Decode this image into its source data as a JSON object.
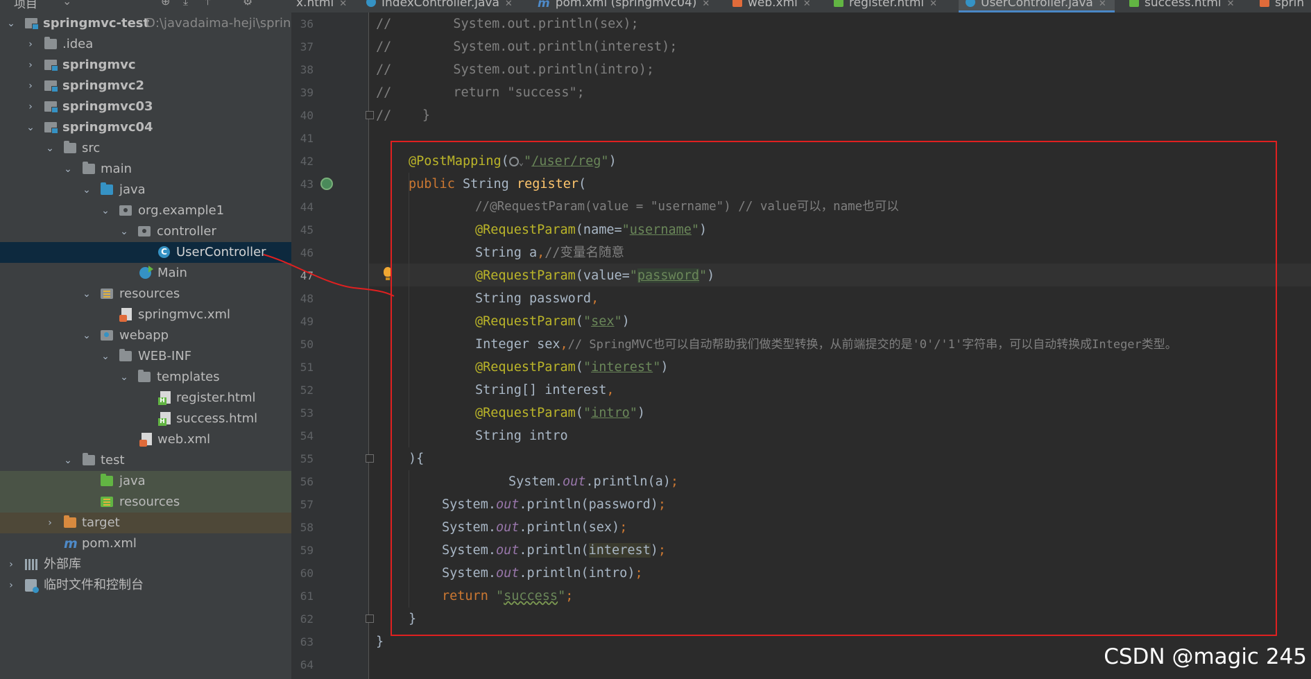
{
  "project_panel": {
    "title": "项目",
    "tree": [
      {
        "label": "springmvc-test",
        "path": "D:\\javadaima-heji\\spring",
        "bold": true,
        "expanded": true,
        "depth": 0,
        "icon": "module-folder-icon"
      },
      {
        "label": ".idea",
        "depth": 1,
        "collapsed": true,
        "icon": "folder-icon"
      },
      {
        "label": "springmvc",
        "bold": true,
        "depth": 1,
        "collapsed": true,
        "icon": "module-folder-icon"
      },
      {
        "label": "springmvc2",
        "bold": true,
        "depth": 1,
        "collapsed": true,
        "icon": "module-folder-icon"
      },
      {
        "label": "springmvc03",
        "bold": true,
        "depth": 1,
        "collapsed": true,
        "icon": "module-folder-icon"
      },
      {
        "label": "springmvc04",
        "bold": true,
        "depth": 1,
        "expanded": true,
        "icon": "module-folder-icon"
      },
      {
        "label": "src",
        "depth": 2,
        "expanded": true,
        "icon": "folder-icon"
      },
      {
        "label": "main",
        "depth": 3,
        "expanded": true,
        "icon": "folder-icon"
      },
      {
        "label": "java",
        "depth": 4,
        "expanded": true,
        "icon": "source-folder-icon"
      },
      {
        "label": "org.example1",
        "depth": 5,
        "expanded": true,
        "icon": "package-icon"
      },
      {
        "label": "controller",
        "depth": 6,
        "expanded": true,
        "icon": "package-icon"
      },
      {
        "label": "UserController",
        "depth": 7,
        "selected": true,
        "icon": "java-class-icon"
      },
      {
        "label": "Main",
        "depth": 6,
        "icon": "java-main-class-icon"
      },
      {
        "label": "resources",
        "depth": 4,
        "expanded": true,
        "icon": "resources-folder-icon"
      },
      {
        "label": "springmvc.xml",
        "depth": 5,
        "icon": "spring-xml-icon"
      },
      {
        "label": "webapp",
        "depth": 4,
        "expanded": true,
        "icon": "web-folder-icon"
      },
      {
        "label": "WEB-INF",
        "depth": 5,
        "expanded": true,
        "icon": "folder-icon"
      },
      {
        "label": "templates",
        "depth": 6,
        "expanded": true,
        "icon": "folder-icon"
      },
      {
        "label": "register.html",
        "depth": 7,
        "icon": "html-file-icon"
      },
      {
        "label": "success.html",
        "depth": 7,
        "icon": "html-file-icon"
      },
      {
        "label": "web.xml",
        "depth": 6,
        "icon": "xml-file-icon"
      },
      {
        "label": "test",
        "depth": 3,
        "expanded": true,
        "icon": "folder-icon"
      },
      {
        "label": "java",
        "depth": 4,
        "icon": "test-source-folder-icon"
      },
      {
        "label": "resources",
        "depth": 4,
        "icon": "test-resources-folder-icon"
      },
      {
        "label": "target",
        "depth": 2,
        "collapsed": true,
        "icon": "excluded-folder-icon"
      },
      {
        "label": "pom.xml",
        "depth": 2,
        "icon": "maven-icon"
      },
      {
        "label": "外部库",
        "depth": 0,
        "collapsed": true,
        "icon": "library-icon"
      },
      {
        "label": "临时文件和控制台",
        "depth": 0,
        "collapsed": true,
        "icon": "scratch-icon"
      }
    ]
  },
  "tabs": [
    {
      "label": "x.html"
    },
    {
      "label": "IndexController.java"
    },
    {
      "label": "pom.xml (springmvc04)"
    },
    {
      "label": "web.xml"
    },
    {
      "label": "register.html"
    },
    {
      "label": "UserController.java",
      "active": true
    },
    {
      "label": "success.html"
    },
    {
      "label": "sprin"
    }
  ],
  "editor": {
    "current_line": "47",
    "line_numbers": [
      "36",
      "37",
      "38",
      "39",
      "40",
      "41",
      "42",
      "43",
      "44",
      "45",
      "46",
      "47",
      "48",
      "49",
      "50",
      "51",
      "52",
      "53",
      "54",
      "55",
      "56",
      "57",
      "58",
      "59",
      "60",
      "61",
      "62",
      "63",
      "64"
    ],
    "lines": {
      "l36": {
        "a": "//",
        "b": "        System.out.println(sex);"
      },
      "l37": {
        "a": "//",
        "b": "        System.out.println(interest);"
      },
      "l38": {
        "a": "//",
        "b": "        System.out.println(intro);"
      },
      "l39": {
        "a": "//",
        "b": "        return \"success\";"
      },
      "l40": {
        "a": "//",
        "b": "    }"
      },
      "l42": {
        "ann": "@PostMapping",
        "p1": "(",
        "q1": "\"",
        "val": "/user/reg",
        "q2": "\"",
        "p2": ")"
      },
      "l43": {
        "kw": "public ",
        "type": "String ",
        "fn": "register",
        "p": "("
      },
      "l44": {
        "cm": "//@RequestParam(value = \"username\") // value可以，name也可以"
      },
      "l45": {
        "ann": "@RequestParam",
        "pre": "(name=",
        "q1": "\"",
        "val": "username",
        "q2": "\"",
        "post": ")"
      },
      "l46": {
        "txt": "String a",
        "comma": ",",
        "cm": "//变量名随意"
      },
      "l47": {
        "ann": "@RequestParam",
        "pre": "(value=",
        "q1": "\"",
        "val": "password",
        "q2": "\"",
        "post": ")"
      },
      "l48": {
        "txt": "String password",
        "comma": ","
      },
      "l49": {
        "ann": "@RequestParam",
        "pre": "(",
        "q1": "\"",
        "val": "sex",
        "q2": "\"",
        "post": ")"
      },
      "l50": {
        "txt": "Integer sex",
        "comma": ",",
        "cm": "// SpringMVC也可以自动帮助我们做类型转换，从前端提交的是'0'/'1'字符串，可以自动转换成Integer类型。"
      },
      "l51": {
        "ann": "@RequestParam",
        "pre": "(",
        "q1": "\"",
        "val": "interest",
        "q2": "\"",
        "post": ")"
      },
      "l52": {
        "txt": "String[] interest",
        "comma": ","
      },
      "l53": {
        "ann": "@RequestParam",
        "pre": "(",
        "q1": "\"",
        "val": "intro",
        "q2": "\"",
        "post": ")"
      },
      "l54": {
        "txt": "String intro"
      },
      "l55": {
        "txt": "){"
      },
      "l56": {
        "a": "System.",
        "f": "out",
        "b": ".println(a)",
        "s": ";"
      },
      "l57": {
        "a": "System.",
        "f": "out",
        "b": ".println(password)",
        "s": ";"
      },
      "l58": {
        "a": "System.",
        "f": "out",
        "b": ".println(sex)",
        "s": ";"
      },
      "l59": {
        "a": "System.",
        "f": "out",
        "b": ".println(",
        "h": "interest",
        "c": ")",
        "s": ";"
      },
      "l60": {
        "a": "System.",
        "f": "out",
        "b": ".println(intro)",
        "s": ";"
      },
      "l61": {
        "kw": "return ",
        "q1": "\"",
        "val": "success",
        "q2": "\"",
        "s": ";"
      },
      "l62": {
        "txt": "}"
      },
      "l63": {
        "txt": "}"
      }
    }
  },
  "watermark": "CSDN @magic 245",
  "colors": {
    "annotation_box": "#e02020",
    "selection": "#0d293e",
    "keyword": "#cc7832",
    "annotation": "#bbb529",
    "string": "#6a8759",
    "comment": "#808080"
  }
}
